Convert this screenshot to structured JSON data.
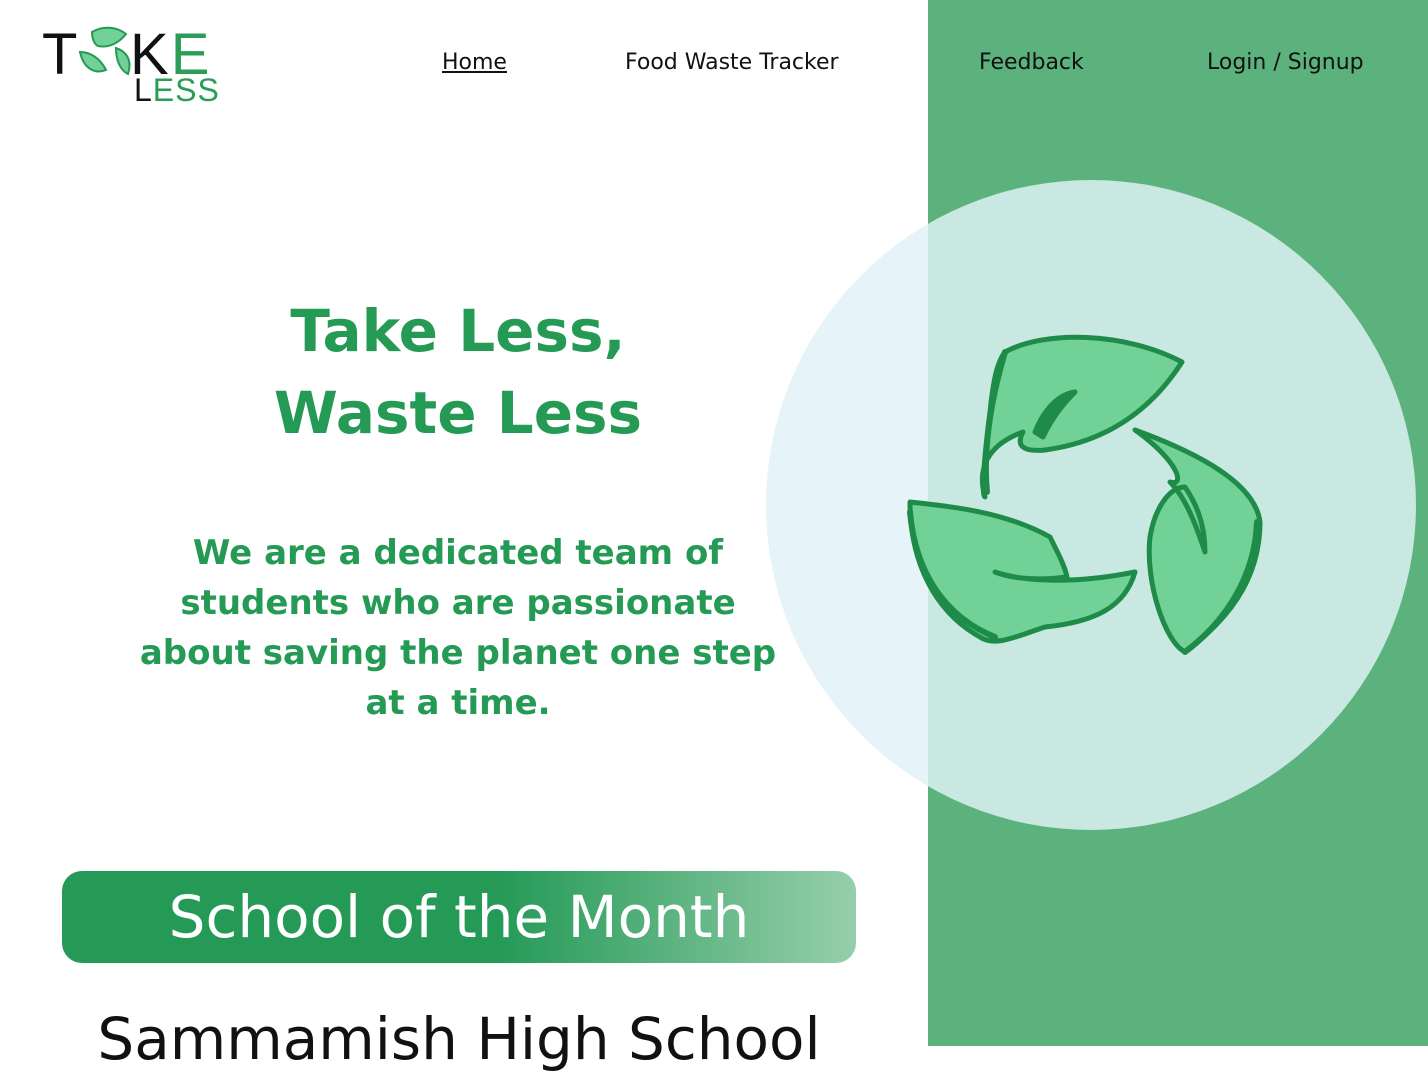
{
  "brand": {
    "logo_top": [
      "T",
      "K",
      "E"
    ],
    "logo_bottom": [
      "L",
      "E",
      "S",
      "S"
    ],
    "icon": "recycle-leaves-icon"
  },
  "nav": {
    "items": [
      {
        "label": "Home",
        "active": true
      },
      {
        "label": "Food Waste Tracker",
        "active": false
      },
      {
        "label": "Feedback",
        "active": false
      },
      {
        "label": "Login / Signup",
        "active": false
      }
    ]
  },
  "hero": {
    "headline_line1": "Take Less,",
    "headline_line2": "Waste Less",
    "tagline": "We are a dedicated team of students who are passionate about saving the planet one step at a time.",
    "illustration": "recycle-leaves-icon"
  },
  "school_of_month": {
    "banner_label": "School of the Month",
    "school_name": "Sammamish High School"
  },
  "colors": {
    "brand_green": "#249a55",
    "panel_green": "#5cb27d",
    "circle_tint": "#c8e8e1",
    "circle_light": "#e6f4f9",
    "leaf_fill": "#72d196",
    "leaf_stroke": "#1e8c48"
  }
}
